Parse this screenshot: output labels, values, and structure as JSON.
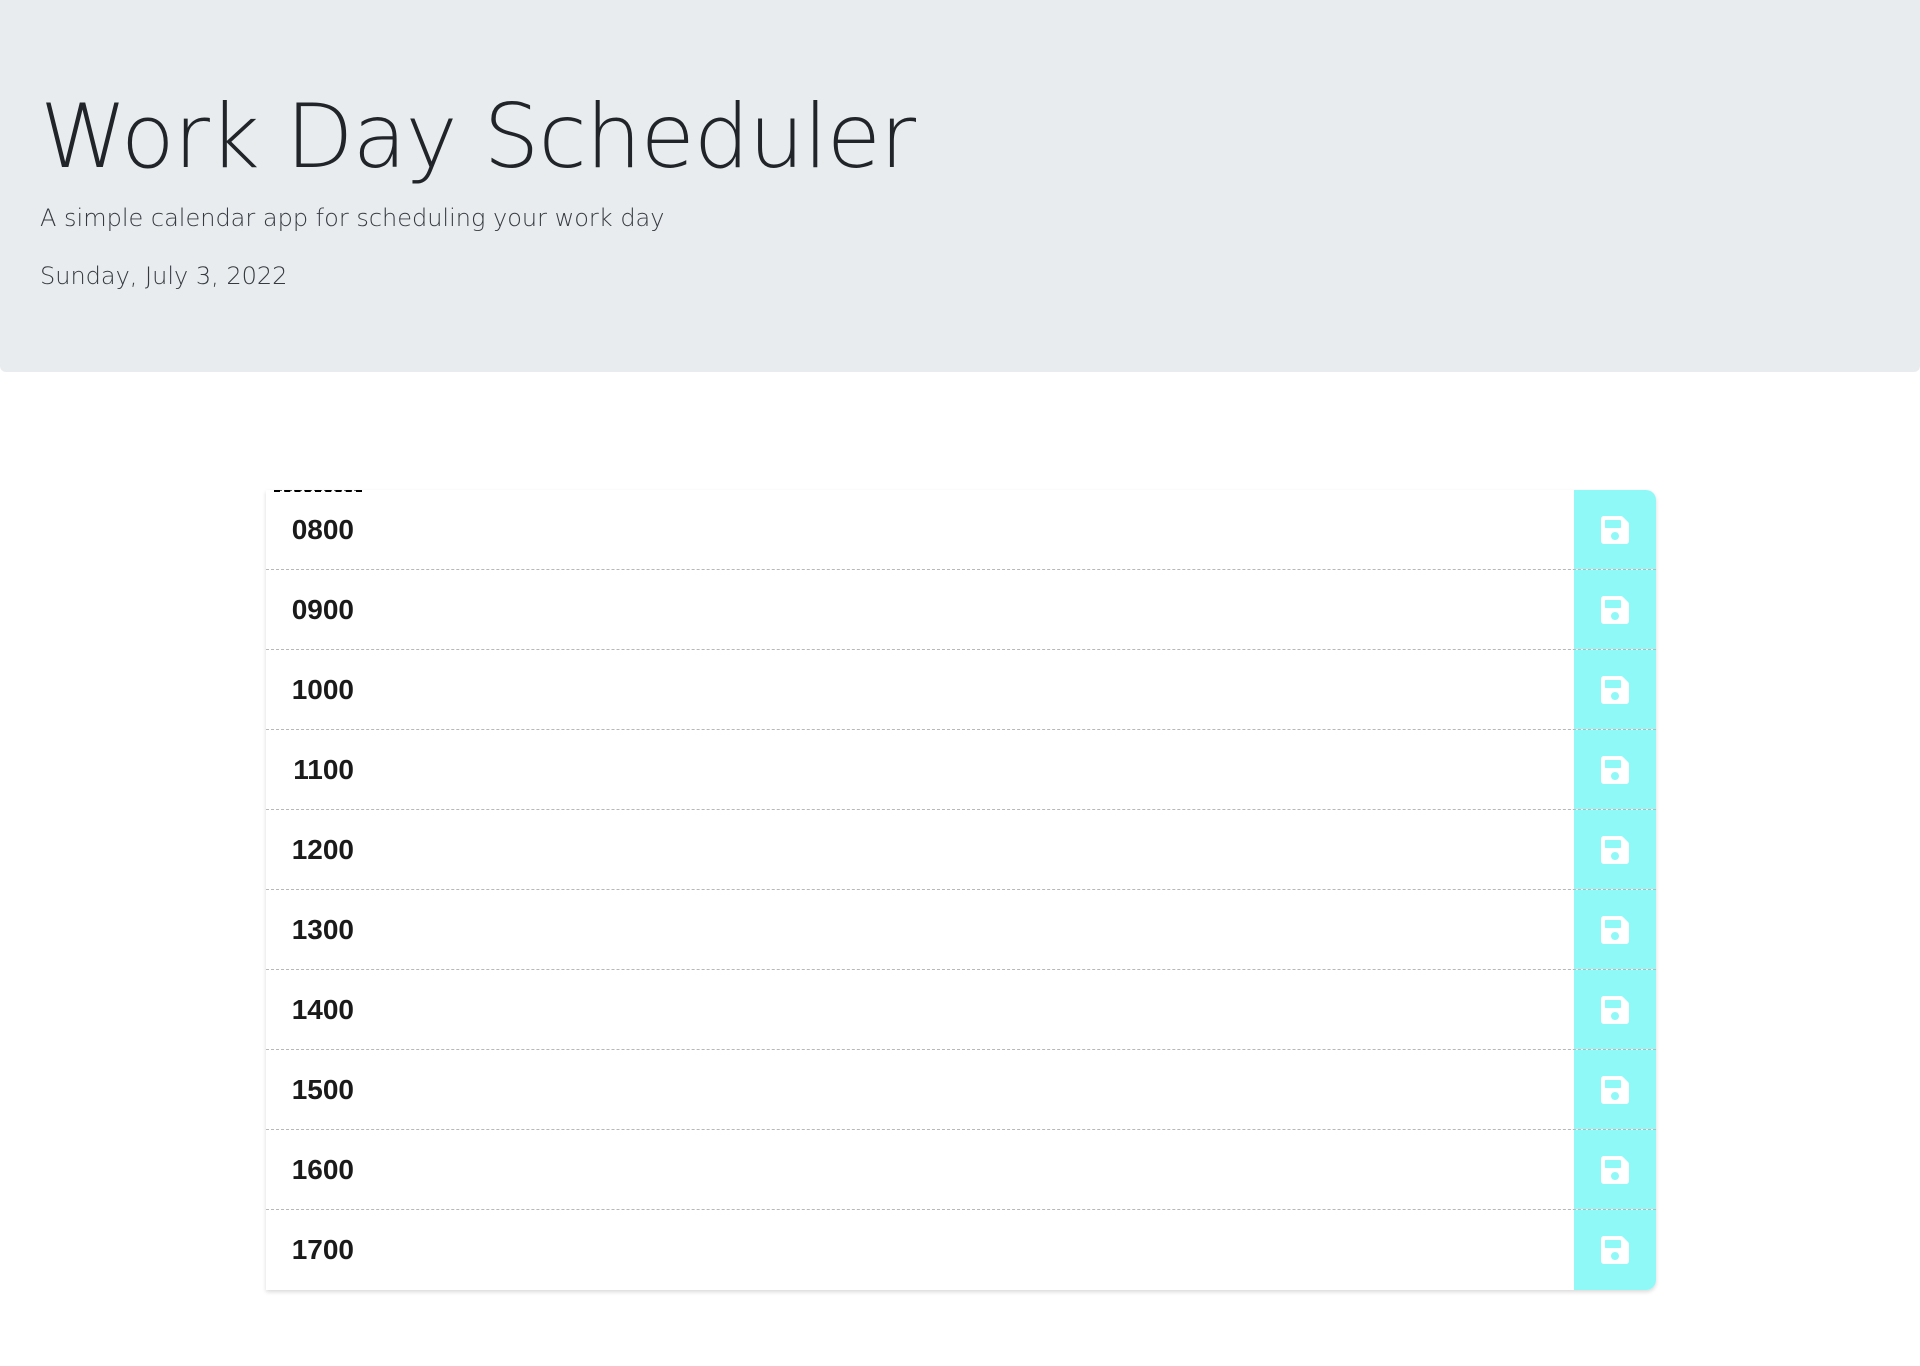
{
  "header": {
    "title": "Work Day Scheduler",
    "subtitle": "A simple calendar app for scheduling your work day",
    "current_day": "Sunday, July 3, 2022"
  },
  "schedule": {
    "rows": [
      {
        "hour": "0800",
        "description": "",
        "save_icon": "floppy-disk-icon"
      },
      {
        "hour": "0900",
        "description": "",
        "save_icon": "floppy-disk-icon"
      },
      {
        "hour": "1000",
        "description": "",
        "save_icon": "floppy-disk-icon"
      },
      {
        "hour": "1100",
        "description": "",
        "save_icon": "floppy-disk-icon"
      },
      {
        "hour": "1200",
        "description": "",
        "save_icon": "floppy-disk-icon"
      },
      {
        "hour": "1300",
        "description": "",
        "save_icon": "floppy-disk-icon"
      },
      {
        "hour": "1400",
        "description": "",
        "save_icon": "floppy-disk-icon"
      },
      {
        "hour": "1500",
        "description": "",
        "save_icon": "floppy-disk-icon"
      },
      {
        "hour": "1600",
        "description": "",
        "save_icon": "floppy-disk-icon"
      },
      {
        "hour": "1700",
        "description": "",
        "save_icon": "floppy-disk-icon"
      }
    ]
  },
  "colors": {
    "header_background": "#e9ecef",
    "save_button_background": "#8ff9f8",
    "save_icon": "#ffffff"
  }
}
